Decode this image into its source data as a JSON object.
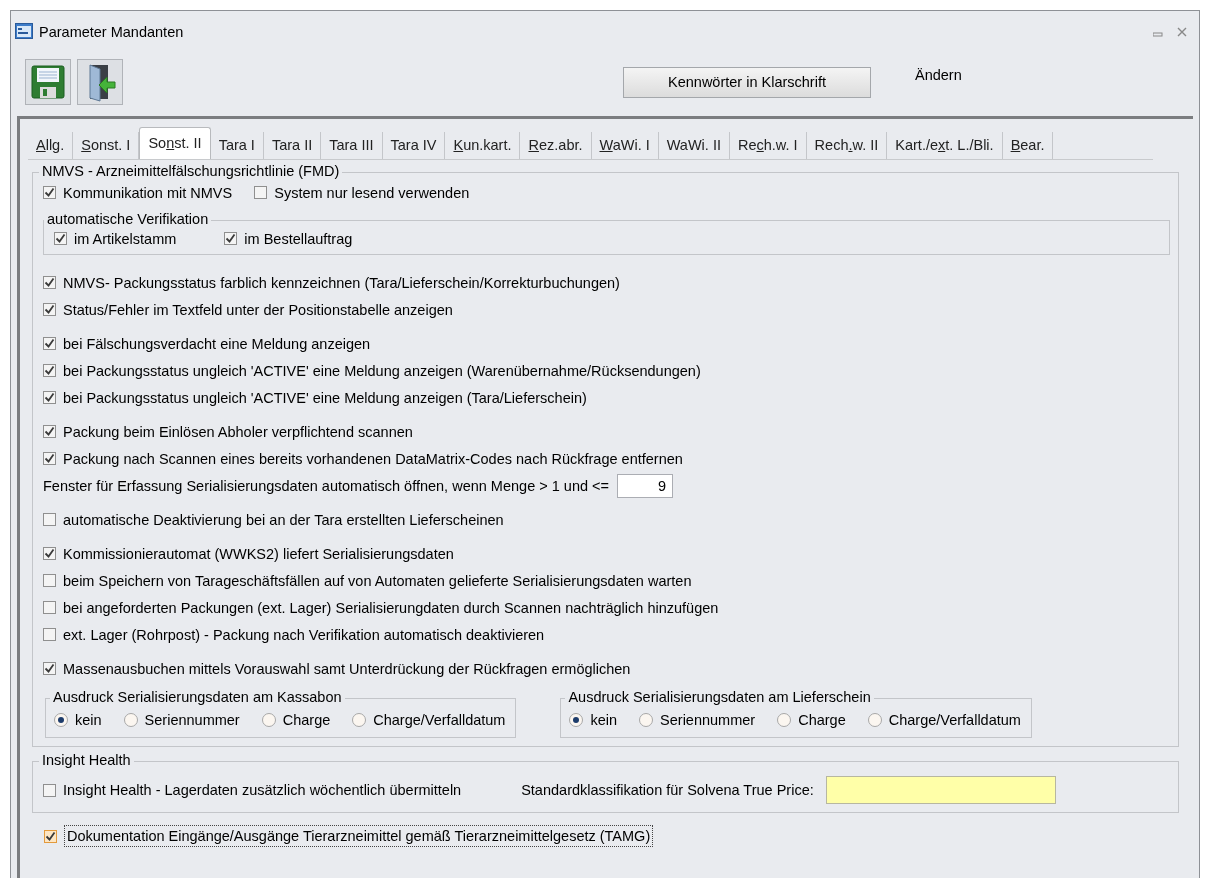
{
  "window": {
    "title": "Parameter Mandanten"
  },
  "toolbar": {
    "buttons": [
      {
        "kind": "save"
      },
      {
        "kind": "exit"
      }
    ],
    "password_button": "Kennwörter in Klarschrift",
    "mode_label": "Ändern"
  },
  "tabs": [
    {
      "key": "A",
      "after": "llg.",
      "selected": false
    },
    {
      "key": "S",
      "after": "onst. I",
      "selected": false
    },
    {
      "before": "So",
      "key": "n",
      "after": "st. II",
      "selected": true
    },
    {
      "before": "Tara I",
      "selected": false
    },
    {
      "before": "Tara II",
      "selected": false
    },
    {
      "before": "Tara III",
      "selected": false
    },
    {
      "before": "Tara IV",
      "selected": false
    },
    {
      "key": "K",
      "after": "un.kart.",
      "selected": false
    },
    {
      "key": "R",
      "after": "ez.abr.",
      "selected": false
    },
    {
      "key": "W",
      "after": "aWi. I",
      "selected": false
    },
    {
      "before": "WaWi. II",
      "selected": false
    },
    {
      "before": "Re",
      "key": "c",
      "after": "h.w. I",
      "selected": false
    },
    {
      "before": "Rech",
      "key": ".",
      "after": "w. II",
      "selected": false
    },
    {
      "before": "Kart./e",
      "key": "x",
      "after": "t. L./Bli.",
      "selected": false
    },
    {
      "key": "B",
      "after": "ear.",
      "selected": false
    }
  ],
  "fmd_group": {
    "title": "NMVS - Arzneimittelfälschungsrichtlinie (FMD)",
    "top_row": [
      {
        "label": "Kommunikation mit NMVS",
        "checked": true
      },
      {
        "label": "System nur lesend verwenden",
        "checked": false
      }
    ],
    "auto_verification": {
      "title": "automatische Verifikation",
      "options": [
        {
          "label": "im Artikelstamm",
          "checked": true
        },
        {
          "label": "im Bestellauftrag",
          "checked": true
        }
      ]
    },
    "blocks": [
      [
        {
          "kind": "checkbox",
          "label": "NMVS- Packungsstatus farblich kennzeichnen (Tara/Lieferschein/Korrekturbuchungen)",
          "checked": true
        },
        {
          "kind": "checkbox",
          "label": "Status/Fehler im Textfeld unter der Positionstabelle anzeigen",
          "checked": true
        }
      ],
      [
        {
          "kind": "checkbox",
          "label": "bei Fälschungsverdacht eine Meldung anzeigen",
          "checked": true
        },
        {
          "kind": "checkbox",
          "label": "bei Packungsstatus ungleich 'ACTIVE' eine Meldung anzeigen (Warenübernahme/Rücksendungen)",
          "checked": true
        },
        {
          "kind": "checkbox",
          "label": "bei Packungsstatus ungleich 'ACTIVE' eine Meldung anzeigen (Tara/Lieferschein)",
          "checked": true
        }
      ],
      [
        {
          "kind": "checkbox",
          "label": "Packung beim Einlösen Abholer verpflichtend scannen",
          "checked": true
        },
        {
          "kind": "checkbox",
          "label": "Packung nach Scannen eines bereits vorhandenen DataMatrix-Codes nach Rückfrage entfernen",
          "checked": true
        },
        {
          "kind": "number",
          "label": "Fenster für Erfassung Serialisierungsdaten automatisch öffnen, wenn Menge > 1 und <=",
          "value": "9"
        }
      ],
      [
        {
          "kind": "checkbox",
          "label": "automatische Deaktivierung bei an der Tara erstellten Lieferscheinen",
          "checked": false
        }
      ],
      [
        {
          "kind": "checkbox",
          "label": "Kommissionierautomat (WWKS2) liefert Serialisierungsdaten",
          "checked": true
        },
        {
          "kind": "checkbox",
          "label": "beim Speichern von Tarageschäftsfällen auf von Automaten gelieferte Serialisierungsdaten warten",
          "checked": false
        },
        {
          "kind": "checkbox",
          "label": "bei angeforderten Packungen (ext. Lager) Serialisierungdaten durch Scannen nachträglich hinzufügen",
          "checked": false
        },
        {
          "kind": "checkbox",
          "label": "ext. Lager (Rohrpost) -  Packung nach Verifikation automatisch deaktivieren",
          "checked": false
        }
      ],
      [
        {
          "kind": "checkbox",
          "label": "Massenausbuchen mittels Vorauswahl samt Unterdrückung der Rückfragen ermöglichen",
          "checked": true
        }
      ]
    ],
    "print_groups": [
      {
        "title": "Ausdruck Serialisierungsdaten am Kassabon",
        "options": [
          {
            "label": "kein",
            "selected": true
          },
          {
            "label": "Seriennummer",
            "selected": false
          },
          {
            "label": "Charge",
            "selected": false
          },
          {
            "label": "Charge/Verfalldatum",
            "selected": false
          }
        ]
      },
      {
        "title": "Ausdruck Serialisierungsdaten am Lieferschein",
        "options": [
          {
            "label": "kein",
            "selected": true
          },
          {
            "label": "Seriennummer",
            "selected": false
          },
          {
            "label": "Charge",
            "selected": false
          },
          {
            "label": "Charge/Verfalldatum",
            "selected": false
          }
        ]
      }
    ]
  },
  "insight_group": {
    "title": "Insight Health",
    "checkbox": {
      "label": "Insight Health - Lagerdaten zusätzlich wöchentlich übermitteln",
      "checked": false
    },
    "field_label": "Standardklassifikation für Solvena True Price:"
  },
  "tamg": {
    "label": "Dokumentation Eingänge/Ausgänge Tierarzneimittel gemäß Tierarzneimittelgesetz (TAMG)",
    "checked": true,
    "focused": true
  }
}
